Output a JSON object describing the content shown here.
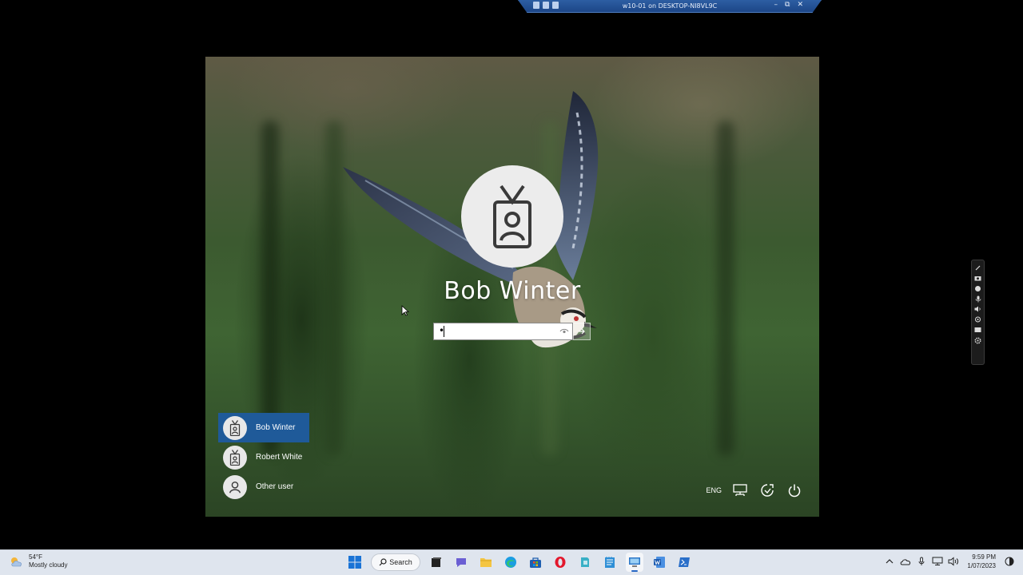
{
  "rdp_bar": {
    "title": "w10-01 on DESKTOP-NI8VL9C",
    "minimize": "–",
    "restore": "⧉",
    "close": "✕"
  },
  "login": {
    "user_name": "Bob Winter",
    "password_value": "•",
    "submit_icon": "arrow-right-icon",
    "reveal_icon": "eye-icon"
  },
  "user_list": {
    "items": [
      {
        "label": "Bob Winter",
        "icon": "badge-user-icon",
        "selected": true
      },
      {
        "label": "Robert White",
        "icon": "badge-user-icon",
        "selected": false
      },
      {
        "label": "Other user",
        "icon": "person-icon",
        "selected": false
      }
    ]
  },
  "bottom_controls": {
    "language": "ENG",
    "network_icon": "network-icon",
    "accessibility_icon": "accessibility-icon",
    "power_icon": "power-icon"
  },
  "taskbar": {
    "weather_temp": "54°F",
    "weather_desc": "Mostly cloudy",
    "search_label": "Search",
    "clock_time": "9:59 PM",
    "clock_date": "1/07/2023",
    "apps": [
      "start-icon",
      "search-pill",
      "file-explorer-dark-icon",
      "teams-icon",
      "folder-icon",
      "edge-icon",
      "store-icon",
      "opera-icon",
      "app-icon",
      "notepad-icon",
      "rdp-icon",
      "word-icon",
      "powershell-icon"
    ]
  },
  "colors": {
    "accent": "#1f5a99",
    "taskbar_bg": "#dfe5ee"
  }
}
